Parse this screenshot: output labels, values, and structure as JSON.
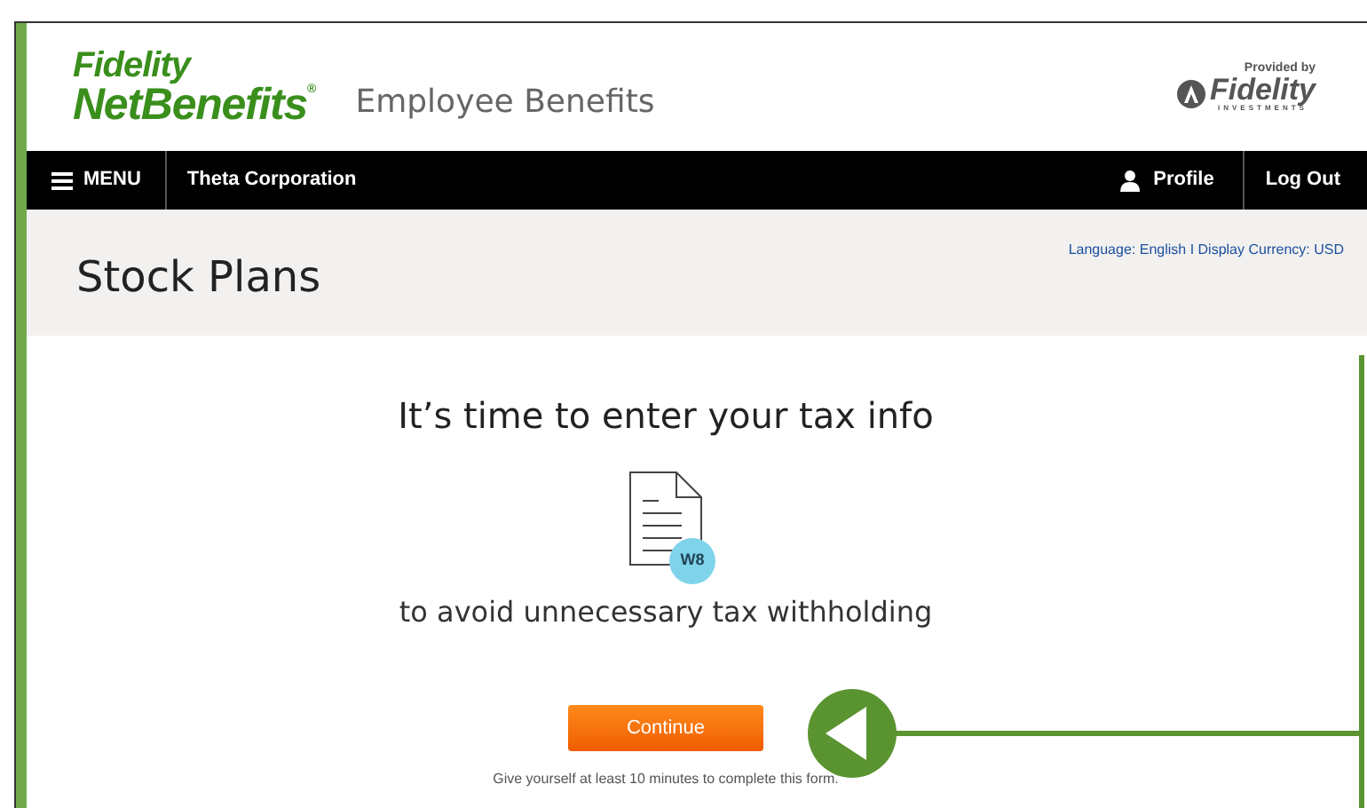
{
  "header": {
    "logo_top": "Fidelity",
    "logo_bottom": "NetBenefits",
    "logo_mark": "®",
    "site_name": "Employee Benefits",
    "provider_label": "Provided by",
    "provider_name": "Fidelity",
    "provider_sub": "INVESTMENTS"
  },
  "nav": {
    "menu": "MENU",
    "company": "Theta Corporation",
    "profile": "Profile",
    "logout": "Log Out"
  },
  "page": {
    "settings_link": "Language: English I Display Currency: USD",
    "title": "Stock Plans"
  },
  "content": {
    "heading": "It’s time to enter your tax info",
    "form_badge": "W8",
    "subtext": "to avoid unnecessary tax withholding",
    "button": "Continue",
    "note": "Give yourself at least 10 minutes to complete this form."
  }
}
